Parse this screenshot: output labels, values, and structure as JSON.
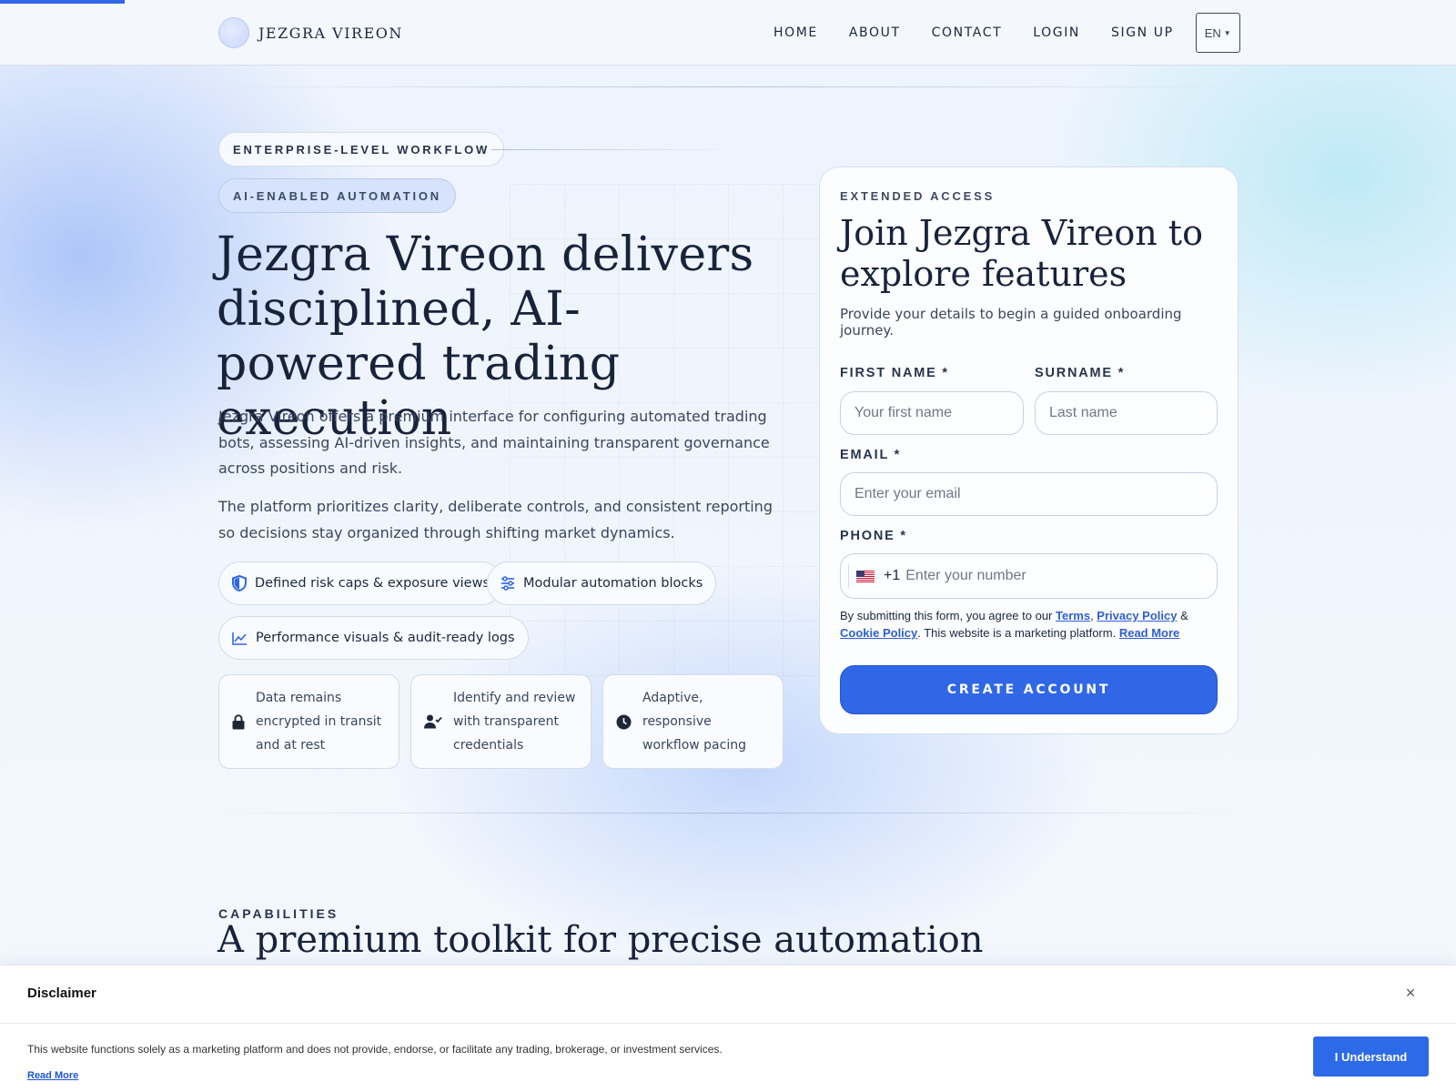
{
  "brand": {
    "name": "JEZGRA VIREON"
  },
  "nav": {
    "items": [
      "HOME",
      "ABOUT",
      "CONTACT",
      "LOGIN",
      "SIGN UP"
    ],
    "language": "EN"
  },
  "hero": {
    "badge_primary": "ENTERPRISE-LEVEL WORKFLOW",
    "badge_secondary": "AI-ENABLED AUTOMATION",
    "title": "Jezgra Vireon delivers disciplined, AI-powered trading execution",
    "paragraph_1": "Jezgra Vireon offers a premium interface for configuring automated trading bots, assessing AI-driven insights, and maintaining transparent governance across positions and risk.",
    "paragraph_2": "The platform prioritizes clarity, deliberate controls, and consistent reporting so decisions stay organized through shifting market dynamics.",
    "pills": [
      {
        "label": "Defined risk caps & exposure views",
        "icon": "shield-icon"
      },
      {
        "label": "Modular automation blocks",
        "icon": "sliders-icon"
      },
      {
        "label": "Performance visuals & audit-ready logs",
        "icon": "chart-line-icon"
      }
    ],
    "cards": [
      {
        "label": "Data remains encrypted in transit and at rest",
        "icon": "lock-icon"
      },
      {
        "label": "Identify and review with transparent credentials",
        "icon": "user-check-icon"
      },
      {
        "label": "Adaptive, responsive workflow pacing",
        "icon": "clock-icon"
      }
    ]
  },
  "form": {
    "eyebrow": "EXTENDED ACCESS",
    "title": "Join Jezgra Vireon to explore features",
    "subtitle": "Provide your details to begin a guided onboarding journey.",
    "first_name_label": "FIRST NAME *",
    "first_name_placeholder": "Your first name",
    "surname_label": "SURNAME *",
    "surname_placeholder": "Last name",
    "email_label": "EMAIL *",
    "email_placeholder": "Enter your email",
    "phone_label": "PHONE *",
    "phone_dial_code": "+1",
    "phone_placeholder": "Enter your number",
    "legal_prefix": "By submitting this form, you agree to our ",
    "terms_link": "Terms",
    "comma": ", ",
    "privacy_link": "Privacy Policy",
    "amp": " & ",
    "cookie_link": "Cookie Policy",
    "legal_middle": ". This website is a marketing platform. ",
    "read_more_link": "Read More",
    "submit_label": "CREATE ACCOUNT"
  },
  "capabilities": {
    "eyebrow": "CAPABILITIES",
    "title": "A premium toolkit for precise automation"
  },
  "disclaimer": {
    "title": "Disclaimer",
    "close": "×",
    "text": "This website functions solely as a marketing platform and does not provide, endorse, or facilitate any trading, brokerage, or investment services.",
    "read_more": "Read More",
    "button": "I Understand"
  },
  "colors": {
    "accent": "#2f67e6",
    "text_dark": "#18233b",
    "link": "#2f5fd1"
  }
}
